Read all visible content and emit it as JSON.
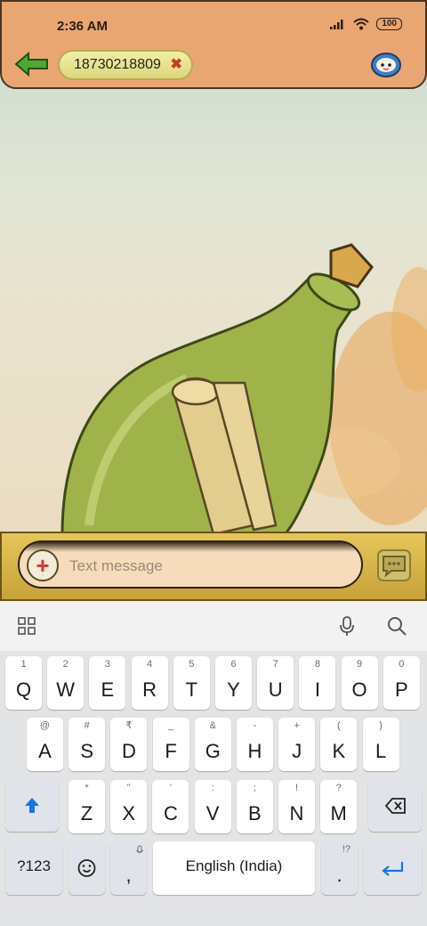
{
  "status_bar": {
    "time": "2:36 AM",
    "battery": "100"
  },
  "header": {
    "recipient": "18730218809"
  },
  "composer": {
    "placeholder": "Text message"
  },
  "keyboard": {
    "row1": [
      {
        "label": "Q",
        "hint": "1"
      },
      {
        "label": "W",
        "hint": "2"
      },
      {
        "label": "E",
        "hint": "3"
      },
      {
        "label": "R",
        "hint": "4"
      },
      {
        "label": "T",
        "hint": "5"
      },
      {
        "label": "Y",
        "hint": "6"
      },
      {
        "label": "U",
        "hint": "7"
      },
      {
        "label": "I",
        "hint": "8"
      },
      {
        "label": "O",
        "hint": "9"
      },
      {
        "label": "P",
        "hint": "0"
      }
    ],
    "row2": [
      {
        "label": "A",
        "hint": "@"
      },
      {
        "label": "S",
        "hint": "#"
      },
      {
        "label": "D",
        "hint": "₹"
      },
      {
        "label": "F",
        "hint": "_"
      },
      {
        "label": "G",
        "hint": "&"
      },
      {
        "label": "H",
        "hint": "-"
      },
      {
        "label": "J",
        "hint": "+"
      },
      {
        "label": "K",
        "hint": "("
      },
      {
        "label": "L",
        "hint": ")"
      }
    ],
    "row3": [
      {
        "label": "Z",
        "hint": "*"
      },
      {
        "label": "X",
        "hint": "\""
      },
      {
        "label": "C",
        "hint": "'"
      },
      {
        "label": "V",
        "hint": ":"
      },
      {
        "label": "B",
        "hint": ";"
      },
      {
        "label": "N",
        "hint": "!"
      },
      {
        "label": "M",
        "hint": "?"
      }
    ],
    "symbols_label": "?123",
    "comma_label": ",",
    "space_label": "English (India)",
    "period_label": ".",
    "period_hint": "!?"
  }
}
